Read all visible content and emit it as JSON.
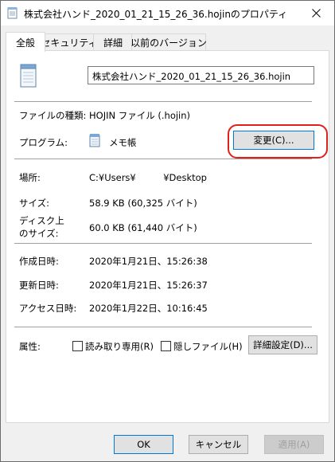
{
  "window": {
    "title": "株式会社ハンド_2020_01_21_15_26_36.hojinのプロパティ"
  },
  "tabs": [
    {
      "label": "全般"
    },
    {
      "label": "セキュリティ"
    },
    {
      "label": "詳細"
    },
    {
      "label": "以前のバージョン"
    }
  ],
  "general": {
    "file_name": "株式会社ハンド_2020_01_21_15_26_36.hojin",
    "file_type_label": "ファイルの種類:",
    "file_type_value": "HOJIN ファイル (.hojin)",
    "program_label": "プログラム:",
    "program_value": "メモ帳",
    "change_button": "変更(C)...",
    "location_label": "場所:",
    "location_value": "C:¥Users¥　　　¥Desktop",
    "size_label": "サイズ:",
    "size_value": "58.9 KB (60,325 バイト)",
    "disk_size_label_1": "ディスク上",
    "disk_size_label_2": "のサイズ:",
    "disk_size_value": "60.0 KB (61,440 バイト)",
    "created_label": "作成日時:",
    "created_value": "2020年1月21日、15:26:38",
    "modified_label": "更新日時:",
    "modified_value": "2020年1月21日、15:26:37",
    "accessed_label": "アクセス日時:",
    "accessed_value": "2020年1月22日、10:16:45",
    "attributes_label": "属性:",
    "readonly_label": "読み取り専用(R)",
    "hidden_label": "隠しファイル(H)",
    "advanced_button": "詳細設定(D)..."
  },
  "footer": {
    "ok": "OK",
    "cancel": "キャンセル",
    "apply": "適用(A)"
  },
  "colors": {
    "highlight": "#e0201b",
    "focus": "#0078d7"
  }
}
